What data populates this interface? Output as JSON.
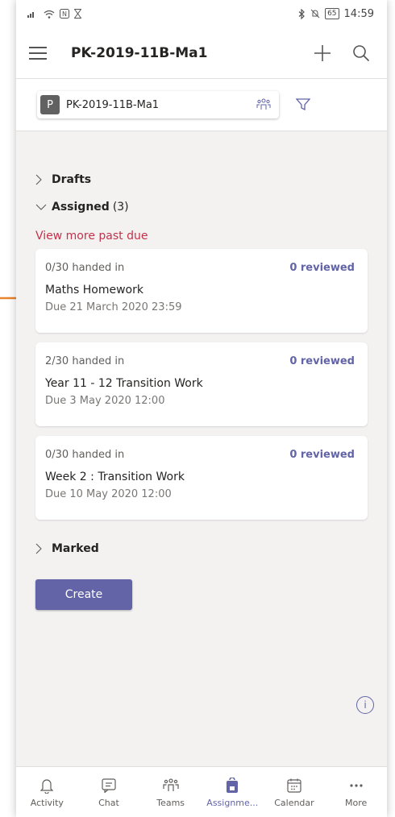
{
  "status": {
    "time": "14:59",
    "battery": "65"
  },
  "appbar": {
    "title": "PK-2019-11B-Ma1"
  },
  "class_filter": {
    "avatar_letter": "P",
    "class_name": "PK-2019-11B-Ma1"
  },
  "sections": {
    "drafts": "Drafts",
    "assigned": "Assigned",
    "assigned_count": "(3)",
    "past_due_link": "View more past due",
    "marked": "Marked"
  },
  "assignments": [
    {
      "handed_in": "0/30 handed in",
      "reviewed": "0 reviewed",
      "title": "Maths Homework",
      "due": "Due 21 March 2020 23:59"
    },
    {
      "handed_in": "2/30 handed in",
      "reviewed": "0 reviewed",
      "title": "Year 11 - 12 Transition Work",
      "due": "Due 3 May 2020 12:00"
    },
    {
      "handed_in": "0/30 handed in",
      "reviewed": "0 reviewed",
      "title": "Week 2 : Transition Work",
      "due": "Due 10 May 2020 12:00"
    }
  ],
  "create_label": "Create",
  "nav": [
    {
      "label": "Activity",
      "icon": "bell-icon"
    },
    {
      "label": "Chat",
      "icon": "chat-icon"
    },
    {
      "label": "Teams",
      "icon": "teams-icon"
    },
    {
      "label": "Assignme...",
      "icon": "assignments-icon",
      "active": true
    },
    {
      "label": "Calendar",
      "icon": "calendar-icon"
    },
    {
      "label": "More",
      "icon": "more-icon"
    }
  ],
  "colors": {
    "accent": "#6264a7",
    "past_due": "#c4314b",
    "annotation_arrow": "#e8832e"
  }
}
